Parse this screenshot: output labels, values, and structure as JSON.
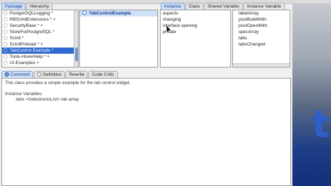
{
  "top_tabs": [
    {
      "label": "Package",
      "active": true
    },
    {
      "label": "Hierarchy",
      "active": false
    }
  ],
  "packages": [
    "PostgreSQLLogging *",
    "RBSUnitExtensions * +",
    "SecurityBase * +",
    "StoreForPostgreSQL *",
    "SUnit *",
    "SUnitPreload * +",
    "TabControl-Example *",
    "Tools-HoverHelp * +",
    "UI-Examples +"
  ],
  "selected_package_index": 6,
  "classes": [
    "TabControlExample"
  ],
  "side_tabs": [
    {
      "label": "Instance",
      "active": true
    },
    {
      "label": "Class",
      "active": false
    },
    {
      "label": "Shared Variable",
      "active": false
    },
    {
      "label": "Instance Variable",
      "active": false
    }
  ],
  "categories": [
    "aspects",
    "changing",
    "interface opening",
    "private"
  ],
  "selectors": [
    "labelArray",
    "postBuildWith:",
    "postOpenWith:",
    "specArray",
    "tabs",
    "tabsChanged"
  ],
  "bottom_tabs": [
    {
      "label": "Comment",
      "active": true
    },
    {
      "label": "Definition",
      "active": false
    },
    {
      "label": "Rewrite",
      "active": false
    },
    {
      "label": "Code Critic",
      "active": false
    }
  ],
  "comment": {
    "line1": "This class provides a simple example for the tab control widget.",
    "line2": "Instance Variables:",
    "line3": "tabs <SelectionInList> tab array"
  },
  "colors": {
    "selection_blue": "#2f6ad0",
    "tab_active": "#cfe0f7",
    "dark_panel": "#1d3d86"
  }
}
